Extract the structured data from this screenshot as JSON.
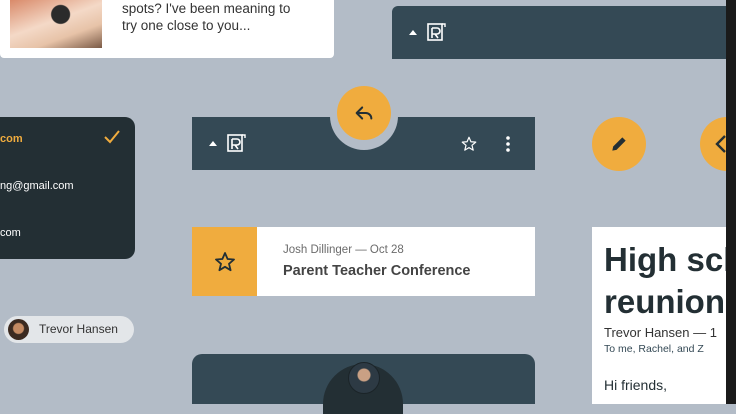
{
  "top_card": {
    "snippet_line1": "spots? I've been meaning to",
    "snippet_line2": "try one close to you..."
  },
  "accounts": {
    "items": [
      {
        "label": "com",
        "selected": true
      },
      {
        "label": "ng@gmail.com",
        "selected": false
      },
      {
        "label": "com",
        "selected": false
      }
    ]
  },
  "chip": {
    "name": "Trevor Hansen"
  },
  "email_card": {
    "meta": "Josh Dillinger — Oct 28",
    "subject": "Parent Teacher Conference"
  },
  "reading_pane": {
    "title": "High school reunion",
    "from": "Trevor Hansen — 1",
    "to": "To me, Rachel, and Z",
    "body": "Hi friends,"
  },
  "colors": {
    "background": "#b3bcc7",
    "app_bar": "#344955",
    "panel_dark": "#232f34",
    "accent": "#f0ac3e"
  }
}
